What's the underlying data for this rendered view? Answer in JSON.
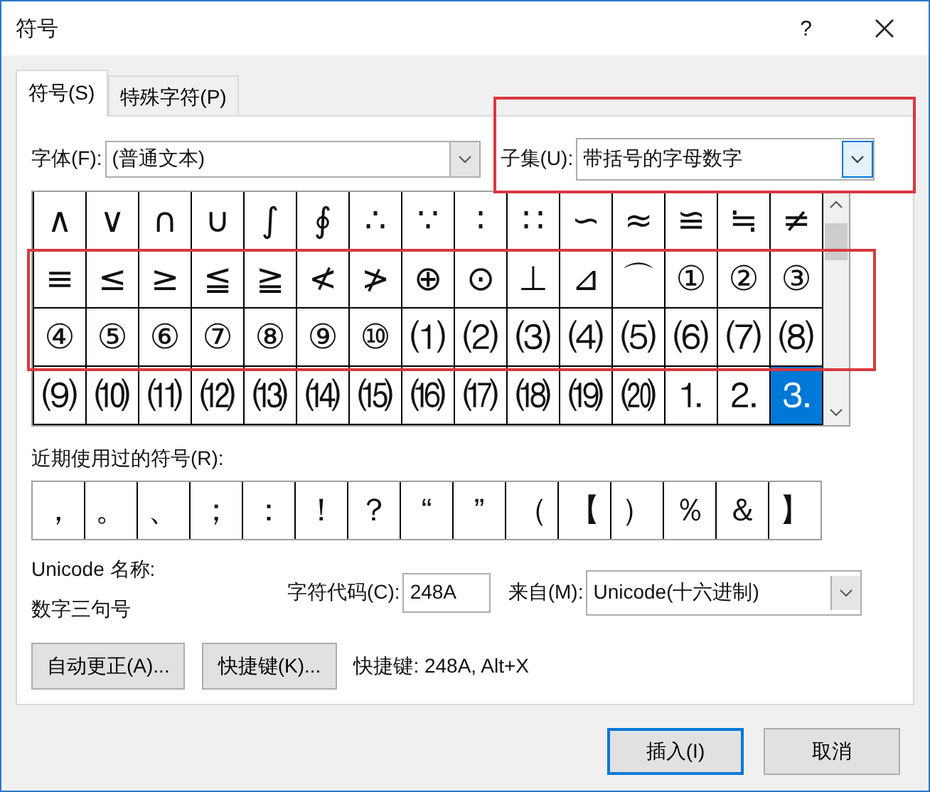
{
  "window": {
    "title": "符号",
    "help": "?"
  },
  "tabs": [
    {
      "label": "符号(S)",
      "selected": true
    },
    {
      "label": "特殊字符(P)",
      "selected": false
    }
  ],
  "font": {
    "label": "字体(F):",
    "value": "(普通文本)"
  },
  "subset": {
    "label": "子集(U):",
    "value": "带括号的字母数字"
  },
  "symbols": [
    {
      "char": "∧",
      "selected": false
    },
    {
      "char": "∨",
      "selected": false
    },
    {
      "char": "∩",
      "selected": false
    },
    {
      "char": "∪",
      "selected": false
    },
    {
      "char": "∫",
      "selected": false
    },
    {
      "char": "∮",
      "selected": false
    },
    {
      "char": "∴",
      "selected": false
    },
    {
      "char": "∵",
      "selected": false
    },
    {
      "char": "∶",
      "selected": false
    },
    {
      "char": "∷",
      "selected": false
    },
    {
      "char": "∽",
      "selected": false
    },
    {
      "char": "≈",
      "selected": false
    },
    {
      "char": "≌",
      "selected": false
    },
    {
      "char": "≒",
      "selected": false
    },
    {
      "char": "≠",
      "selected": false
    },
    {
      "char": "≡",
      "selected": false
    },
    {
      "char": "≤",
      "selected": false
    },
    {
      "char": "≥",
      "selected": false
    },
    {
      "char": "≦",
      "selected": false
    },
    {
      "char": "≧",
      "selected": false
    },
    {
      "char": "≮",
      "selected": false
    },
    {
      "char": "≯",
      "selected": false
    },
    {
      "char": "⊕",
      "selected": false
    },
    {
      "char": "⊙",
      "selected": false
    },
    {
      "char": "⊥",
      "selected": false
    },
    {
      "char": "⊿",
      "selected": false
    },
    {
      "char": "⌒",
      "selected": false
    },
    {
      "char": "①",
      "selected": false
    },
    {
      "char": "②",
      "selected": false
    },
    {
      "char": "③",
      "selected": false
    },
    {
      "char": "④",
      "selected": false
    },
    {
      "char": "⑤",
      "selected": false
    },
    {
      "char": "⑥",
      "selected": false
    },
    {
      "char": "⑦",
      "selected": false
    },
    {
      "char": "⑧",
      "selected": false
    },
    {
      "char": "⑨",
      "selected": false
    },
    {
      "char": "⑩",
      "selected": false
    },
    {
      "char": "⑴",
      "selected": false
    },
    {
      "char": "⑵",
      "selected": false
    },
    {
      "char": "⑶",
      "selected": false
    },
    {
      "char": "⑷",
      "selected": false
    },
    {
      "char": "⑸",
      "selected": false
    },
    {
      "char": "⑹",
      "selected": false
    },
    {
      "char": "⑺",
      "selected": false
    },
    {
      "char": "⑻",
      "selected": false
    },
    {
      "char": "⑼",
      "selected": false
    },
    {
      "char": "⑽",
      "selected": false
    },
    {
      "char": "⑾",
      "selected": false
    },
    {
      "char": "⑿",
      "selected": false
    },
    {
      "char": "⒀",
      "selected": false
    },
    {
      "char": "⒁",
      "selected": false
    },
    {
      "char": "⒂",
      "selected": false
    },
    {
      "char": "⒃",
      "selected": false
    },
    {
      "char": "⒄",
      "selected": false
    },
    {
      "char": "⒅",
      "selected": false
    },
    {
      "char": "⒆",
      "selected": false
    },
    {
      "char": "⒇",
      "selected": false
    },
    {
      "char": "⒈",
      "selected": false
    },
    {
      "char": "⒉",
      "selected": false
    },
    {
      "char": "⒊",
      "selected": true
    }
  ],
  "recent": {
    "label": "近期使用过的符号(R):",
    "symbols": [
      "，",
      "。",
      "、",
      "；",
      "：",
      "！",
      "？",
      "“",
      "”",
      "（",
      "【",
      "）",
      "％",
      "＆",
      "】"
    ]
  },
  "unicode_name": {
    "label": "Unicode 名称:",
    "value": "数字三句号"
  },
  "char_code": {
    "label": "字符代码(C):",
    "value": "248A"
  },
  "from": {
    "label": "来自(M):",
    "value": "Unicode(十六进制)"
  },
  "buttons": [
    {
      "label": "自动更正(A)..."
    },
    {
      "label": "快捷键(K)..."
    }
  ],
  "shortcut": "快捷键: 248A, Alt+X",
  "footer_buttons": [
    {
      "label": "插入(I)",
      "kind": "default"
    },
    {
      "label": "取消",
      "kind": "normal"
    }
  ],
  "annotations": [
    {
      "kind": "frame"
    },
    {
      "kind": "frame"
    }
  ]
}
